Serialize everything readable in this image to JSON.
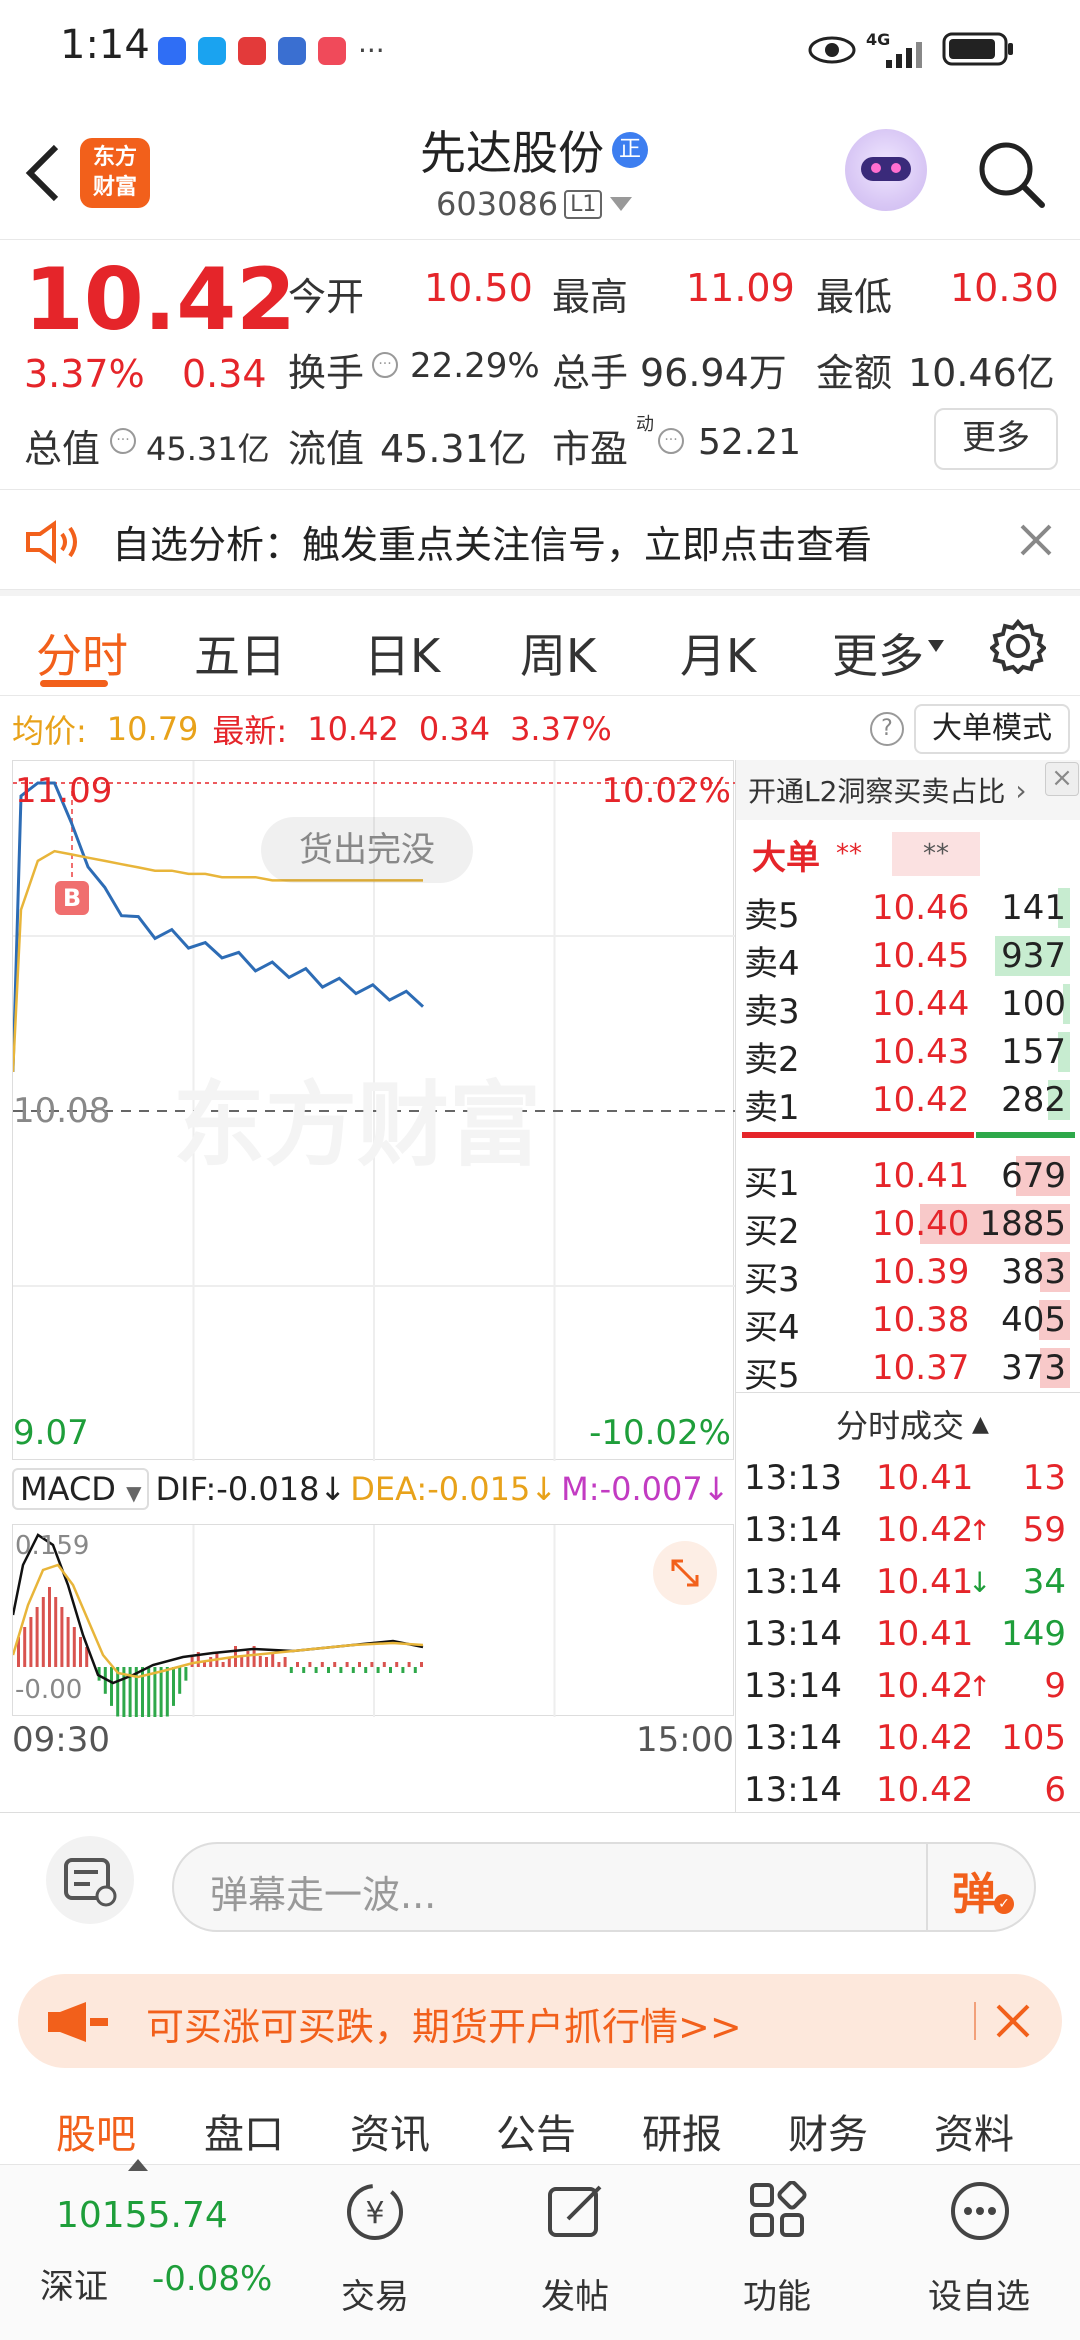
{
  "status_bar": {
    "time": "1:14",
    "dots": "···",
    "network": "4G"
  },
  "header": {
    "stock_name": "先达股份",
    "badge": "正",
    "code": "603086",
    "level": "L1",
    "logo_line1": "东方",
    "logo_line2": "财富"
  },
  "quote": {
    "price": "10.42",
    "pct": "3.37%",
    "change": "0.34",
    "open_label": "今开",
    "open": "10.50",
    "high_label": "最高",
    "high": "11.09",
    "low_label": "最低",
    "low": "10.30",
    "turnover_label": "换手",
    "turnover": "22.29%",
    "volume_label": "总手",
    "volume": "96.94万",
    "amount_label": "金额",
    "amount": "10.46亿",
    "mktcap_label": "总值",
    "mktcap": "45.31亿",
    "float_label": "流值",
    "float": "45.31亿",
    "pe_label": "市盈",
    "pe_sup": "动",
    "pe": "52.21",
    "more": "更多"
  },
  "banner": {
    "text": "自选分析：触发重点关注信号，立即点击查看"
  },
  "tabs": [
    "分时",
    "五日",
    "日K",
    "周K",
    "月K",
    "更多"
  ],
  "info_line": {
    "avg_label": "均价:",
    "avg": "10.79",
    "latest_label": "最新:",
    "latest": "10.42",
    "chg": "0.34",
    "pct": "3.37%",
    "mode": "大单模式"
  },
  "chart": {
    "top_price": "11.09",
    "top_pct": "10.02%",
    "mid_price": "10.08",
    "bottom_price": "9.07",
    "bottom_pct": "-10.02%",
    "bubble": "货出完没",
    "marker": "B",
    "watermark": "东方财富",
    "macd_label": "MACD",
    "dif": "DIF:-0.018",
    "dea": "DEA:-0.015",
    "m": "M:-0.007",
    "macd_top": "0.159",
    "macd_bottom": "-0.00",
    "time_start": "09:30",
    "time_end": "15:00"
  },
  "chart_data": {
    "type": "line",
    "title": "",
    "ylim": [
      9.07,
      11.09
    ],
    "series": [
      {
        "name": "最新",
        "values": [
          10.2,
          11.05,
          11.09,
          11.09,
          10.95,
          10.85,
          10.75,
          10.7,
          10.66,
          10.63,
          10.62,
          10.6,
          10.58,
          10.57,
          10.55,
          10.53,
          10.52,
          10.51,
          10.5,
          10.48,
          10.47,
          10.46,
          10.45,
          10.44,
          10.43,
          10.42
        ]
      },
      {
        "name": "均价",
        "values": [
          10.2,
          10.7,
          10.85,
          10.88,
          10.87,
          10.86,
          10.85,
          10.84,
          10.83,
          10.82,
          10.82,
          10.81,
          10.81,
          10.8,
          10.8,
          10.8,
          10.79,
          10.79,
          10.79,
          10.79,
          10.79,
          10.79,
          10.79,
          10.79,
          10.79,
          10.79
        ]
      }
    ]
  },
  "orderbook": {
    "promo": "开通L2洞察买卖占比",
    "big_label": "大单",
    "big_v1": "**",
    "big_v2": "**",
    "asks": [
      {
        "label": "卖5",
        "price": "10.46",
        "vol": "141",
        "bar": 0.08
      },
      {
        "label": "卖4",
        "price": "10.45",
        "vol": "937",
        "bar": 0.5
      },
      {
        "label": "卖3",
        "price": "10.44",
        "vol": "100",
        "bar": 0.05
      },
      {
        "label": "卖2",
        "price": "10.43",
        "vol": "157",
        "bar": 0.08
      },
      {
        "label": "卖1",
        "price": "10.42",
        "vol": "282",
        "bar": 0.15
      }
    ],
    "bids": [
      {
        "label": "买1",
        "price": "10.41",
        "vol": "679",
        "bar": 0.36
      },
      {
        "label": "买2",
        "price": "10.40",
        "vol": "1885",
        "bar": 1.0
      },
      {
        "label": "买3",
        "price": "10.39",
        "vol": "383",
        "bar": 0.2
      },
      {
        "label": "买4",
        "price": "10.38",
        "vol": "405",
        "bar": 0.21
      },
      {
        "label": "买5",
        "price": "10.37",
        "vol": "373",
        "bar": 0.2
      }
    ]
  },
  "ticks": {
    "title": "分时成交",
    "rows": [
      {
        "time": "13:13",
        "price": "10.41",
        "arrow": "",
        "vol": "13",
        "color": "red"
      },
      {
        "time": "13:14",
        "price": "10.42",
        "arrow": "↑",
        "vol": "59",
        "color": "red"
      },
      {
        "time": "13:14",
        "price": "10.41",
        "arrow": "↓",
        "vol": "34",
        "color": "green"
      },
      {
        "time": "13:14",
        "price": "10.41",
        "arrow": "",
        "vol": "149",
        "color": "green"
      },
      {
        "time": "13:14",
        "price": "10.42",
        "arrow": "↑",
        "vol": "9",
        "color": "red"
      },
      {
        "time": "13:14",
        "price": "10.42",
        "arrow": "",
        "vol": "105",
        "color": "red"
      },
      {
        "time": "13:14",
        "price": "10.42",
        "arrow": "",
        "vol": "6",
        "color": "red"
      }
    ]
  },
  "danmu": {
    "placeholder": "弹幕走一波...",
    "send": "弹"
  },
  "ad": {
    "text": "可买涨可买跌，期货开户抓行情>>"
  },
  "bottom_tabs": [
    "股吧",
    "盘口",
    "资讯",
    "公告",
    "研报",
    "财务",
    "资料"
  ],
  "bottom_nav": {
    "index_value": "10155.74",
    "index_name": "深证",
    "index_chg": "-0.08%",
    "trade": "交易",
    "post": "发帖",
    "func": "功能",
    "watch": "设自选"
  }
}
